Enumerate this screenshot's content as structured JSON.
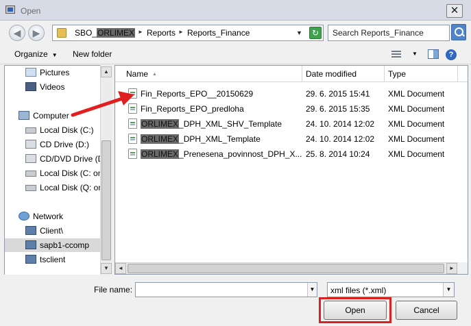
{
  "window": {
    "title": "Open",
    "close_glyph": "✕"
  },
  "address": {
    "crumbs": [
      "SBO_",
      "ORLIMEX",
      "Reports",
      "Reports_Finance"
    ],
    "separator": "►",
    "dropdown_glyph": "▼",
    "refresh_glyph": "↻"
  },
  "search": {
    "placeholder": "Search Reports_Finance"
  },
  "nav_buttons": {
    "back_glyph": "◀",
    "forward_glyph": "▶"
  },
  "toolbar": {
    "organize_label": "Organize",
    "new_folder_label": "New folder",
    "dropdown_glyph": "▼",
    "help_glyph": "?"
  },
  "sidebar": {
    "items": [
      {
        "label": "Pictures",
        "icon": "pictures-icon"
      },
      {
        "label": "Videos",
        "icon": "videos-icon"
      },
      {
        "label": "Computer",
        "icon": "computer-icon"
      },
      {
        "label": "Local Disk (C:)",
        "icon": "disk-icon"
      },
      {
        "label": "CD Drive (D:)",
        "icon": "cd-drive-icon"
      },
      {
        "label": "CD/DVD Drive (D",
        "icon": "cd-drive-icon"
      },
      {
        "label": "Local Disk (C: on",
        "icon": "disk-icon"
      },
      {
        "label": "Local Disk (Q: on",
        "icon": "disk-icon"
      },
      {
        "label": "Network",
        "icon": "network-icon"
      },
      {
        "label": "Client\\",
        "icon": "network-computer-icon"
      },
      {
        "label": "sapb1-ccomp",
        "icon": "network-computer-icon",
        "selected": true
      },
      {
        "label": "tsclient",
        "icon": "network-computer-icon"
      }
    ]
  },
  "file_list": {
    "columns": [
      "Name",
      "Date modified",
      "Type"
    ],
    "sort_glyph": "▲",
    "rows": [
      {
        "name_parts": [
          "",
          "Fin_Reports_EPO__20150629"
        ],
        "date": "29. 6. 2015 15:41",
        "type": "XML Document"
      },
      {
        "name_parts": [
          "",
          "Fin_Reports_EPO_predloha"
        ],
        "date": "29. 6. 2015 15:35",
        "type": "XML Document"
      },
      {
        "name_parts": [
          "ORLIMEX",
          "_DPH_XML_SHV_Template"
        ],
        "date": "24. 10. 2014 12:02",
        "type": "XML Document"
      },
      {
        "name_parts": [
          "ORLIMEX",
          "_DPH_XML_Template"
        ],
        "date": "24. 10. 2014 12:02",
        "type": "XML Document"
      },
      {
        "name_parts": [
          "ORLIMEX",
          "_Prenesena_povinnost_DPH_X..."
        ],
        "date": "25. 8. 2014 10:24",
        "type": "XML Document"
      }
    ]
  },
  "scroll": {
    "up_glyph": "▲",
    "down_glyph": "▼",
    "left_glyph": "◄",
    "right_glyph": "►"
  },
  "footer": {
    "file_name_label": "File name:",
    "file_name_value": "",
    "filter_value": "xml files (*.xml)",
    "dropdown_glyph": "▼",
    "open_label": "Open",
    "cancel_label": "Cancel"
  },
  "annotations": {
    "arrow_color": "#e02020",
    "highlight_color": "#d82222"
  }
}
